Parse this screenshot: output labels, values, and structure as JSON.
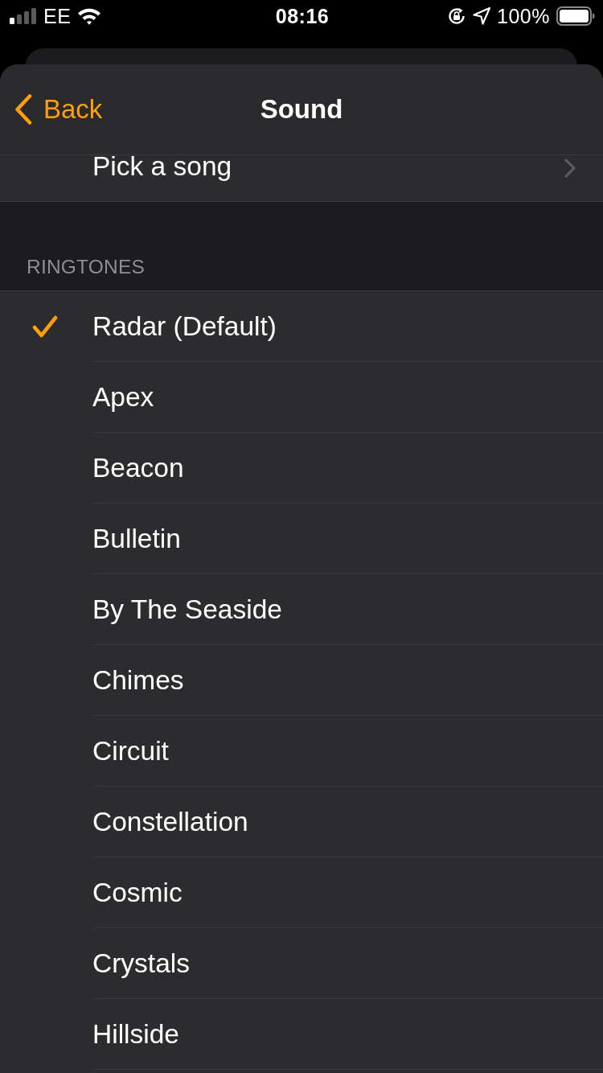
{
  "status_bar": {
    "carrier": "EE",
    "time": "08:16",
    "battery": "100%"
  },
  "nav": {
    "back": "Back",
    "title": "Sound"
  },
  "song_row": {
    "label": "Pick a song"
  },
  "section": {
    "header": "RINGTONES"
  },
  "ringtones": [
    {
      "name": "Radar (Default)",
      "selected": true
    },
    {
      "name": "Apex",
      "selected": false
    },
    {
      "name": "Beacon",
      "selected": false
    },
    {
      "name": "Bulletin",
      "selected": false
    },
    {
      "name": "By The Seaside",
      "selected": false
    },
    {
      "name": "Chimes",
      "selected": false
    },
    {
      "name": "Circuit",
      "selected": false
    },
    {
      "name": "Constellation",
      "selected": false
    },
    {
      "name": "Cosmic",
      "selected": false
    },
    {
      "name": "Crystals",
      "selected": false
    },
    {
      "name": "Hillside",
      "selected": false
    }
  ]
}
